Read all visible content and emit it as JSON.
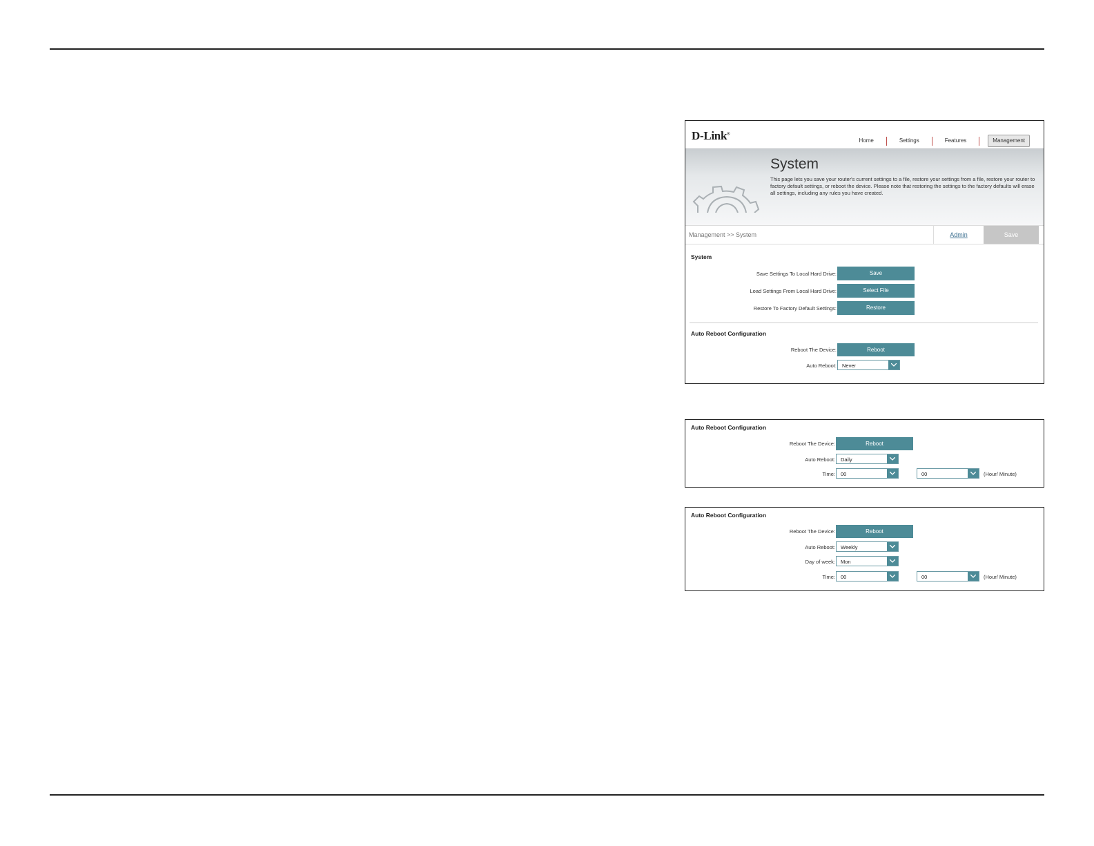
{
  "main": {
    "logo": "D-Link",
    "nav": {
      "home": "Home",
      "settings": "Settings",
      "features": "Features",
      "management": "Management"
    },
    "banner": {
      "title": "System",
      "description": "This page lets you save your router's current settings to a file, restore your settings from a file, restore your router to factory default settings, or reboot the device. Please note that restoring the settings to the factory defaults will erase all settings, including any rules you have created."
    },
    "breadcrumb": "Management >> System",
    "admin_link": "Admin",
    "save_top": "Save",
    "system_section": {
      "title": "System",
      "save_label": "Save Settings To Local Hard Drive:",
      "save_button": "Save",
      "load_label": "Load Settings From Local Hard Drive:",
      "load_button": "Select File",
      "restore_label": "Restore To Factory Default Settings:",
      "restore_button": "Restore"
    },
    "auto_reboot": {
      "title": "Auto Reboot Configuration",
      "reboot_label": "Reboot The Device:",
      "reboot_button": "Reboot",
      "auto_reboot_label": "Auto Reboot:",
      "auto_reboot_value": "Never"
    }
  },
  "daily": {
    "title": "Auto Reboot Configuration",
    "reboot_label": "Reboot The Device:",
    "reboot_button": "Reboot",
    "auto_reboot_label": "Auto Reboot:",
    "auto_reboot_value": "Daily",
    "time_label": "Time:",
    "hour_value": "00",
    "minute_value": "00",
    "time_unit": "(Hour/ Minute)"
  },
  "weekly": {
    "title": "Auto Reboot Configuration",
    "reboot_label": "Reboot The Device:",
    "reboot_button": "Reboot",
    "auto_reboot_label": "Auto Reboot:",
    "auto_reboot_value": "Weekly",
    "day_label": "Day of week:",
    "day_value": "Mon",
    "time_label": "Time:",
    "hour_value": "00",
    "minute_value": "00",
    "time_unit": "(Hour/ Minute)"
  },
  "colors": {
    "button": "#4d8b97",
    "nav_separator": "#c0504d",
    "link": "#3a6e8f"
  }
}
